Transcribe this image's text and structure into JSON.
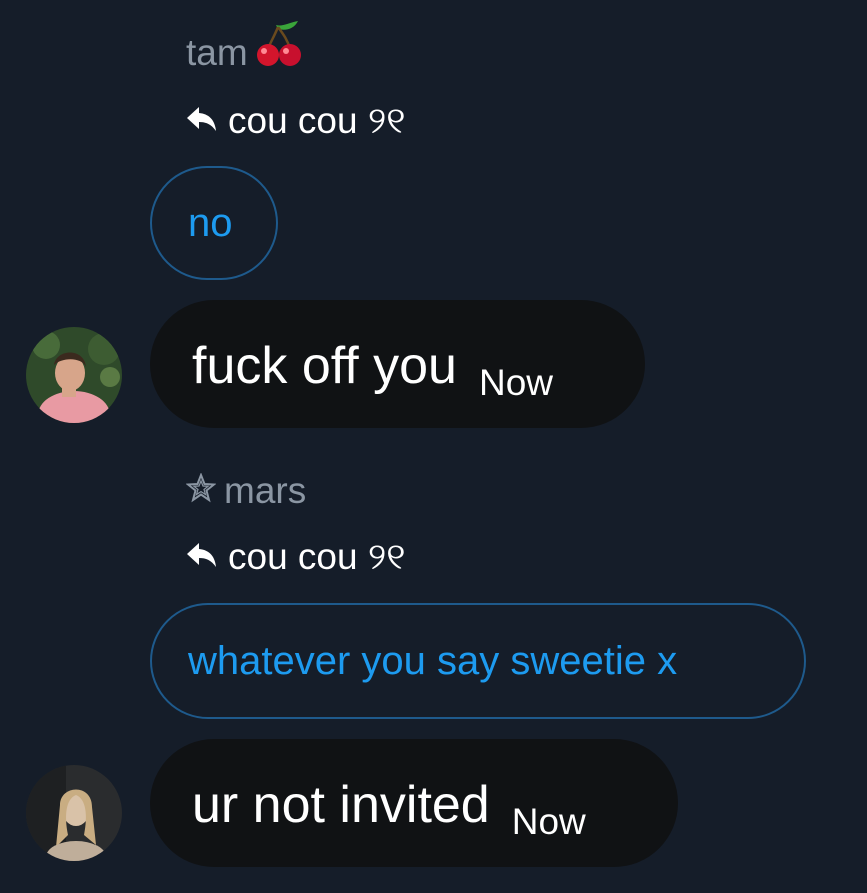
{
  "messages": [
    {
      "sender": "tam",
      "sender_emoji": "cherries",
      "reply_prefix_icon": "reply-arrow-icon",
      "reply_to": "cou cou ୨୧",
      "quoted_text": "no",
      "text": "fuck off you",
      "time": "Now"
    },
    {
      "sender": "mars",
      "sender_icon": "star-icon",
      "reply_prefix_icon": "reply-arrow-icon",
      "reply_to": "cou cou ୨୧",
      "quoted_text": "whatever you say sweetie x",
      "text": "ur not invited",
      "time": "Now"
    }
  ],
  "colors": {
    "background": "#151d29",
    "quote_border": "#1e5a8c",
    "quote_text": "#1d9bf0",
    "bubble": "#101214",
    "name": "#8b96a3",
    "text": "#ffffff"
  }
}
